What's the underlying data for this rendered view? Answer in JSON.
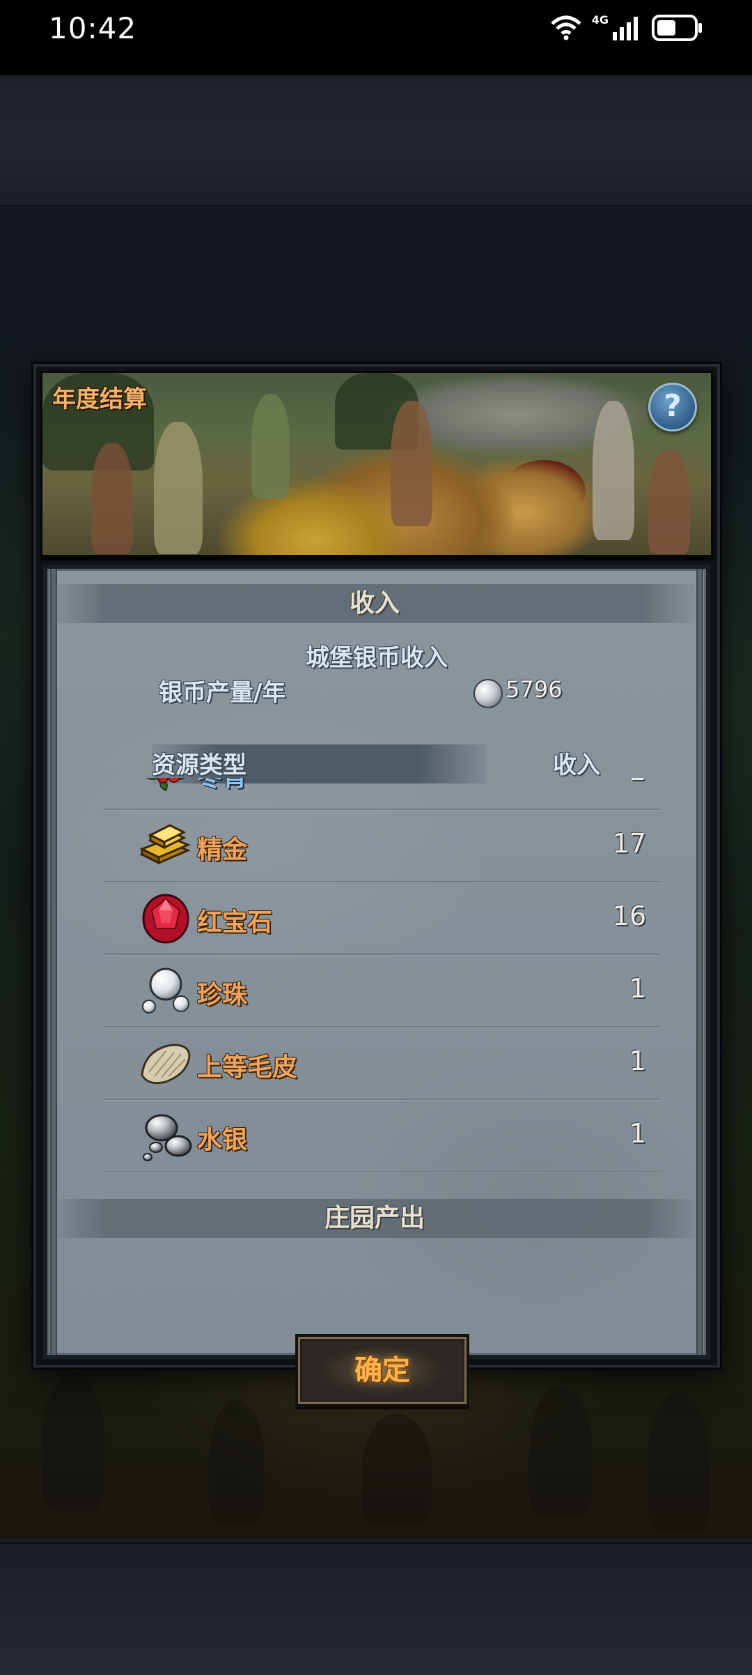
{
  "status_bar": {
    "time": "10:42",
    "network": "4G",
    "icons": [
      "wifi-icon",
      "signal-icon",
      "battery-icon"
    ]
  },
  "dialog": {
    "title": "年度结算",
    "help_label": "?",
    "income_section": {
      "title": "收入",
      "castle_income_title": "城堡银币收入",
      "silver_output_label": "银币产量/年",
      "silver_output_value": "5796",
      "columns": {
        "type": "资源类型",
        "income": "收入"
      },
      "resources": [
        {
          "name": "冬青",
          "value": "2",
          "icon": "holly-icon"
        },
        {
          "name": "精金",
          "value": "17",
          "icon": "gold-bar-icon"
        },
        {
          "name": "红宝石",
          "value": "16",
          "icon": "ruby-icon"
        },
        {
          "name": "珍珠",
          "value": "1",
          "icon": "pearl-icon"
        },
        {
          "name": "上等毛皮",
          "value": "1",
          "icon": "fur-icon"
        },
        {
          "name": "水银",
          "value": "1",
          "icon": "mercury-icon"
        }
      ]
    },
    "manor_section": {
      "title": "庄园产出"
    },
    "confirm_label": "确定"
  },
  "colors": {
    "resource_name": "#f0a35a",
    "panel": "#87919a",
    "button_text": "#ffb34a"
  }
}
